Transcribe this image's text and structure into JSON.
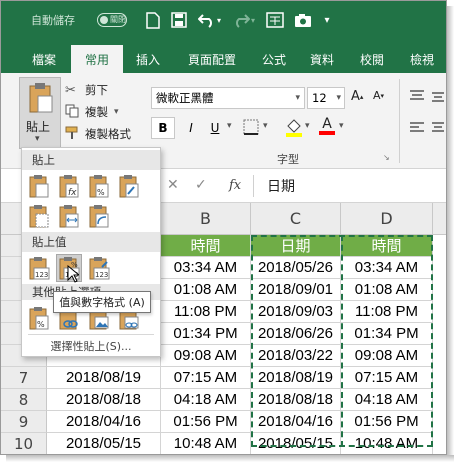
{
  "qat": {
    "autosave_label": "自動儲存",
    "toggle_state": "關閉"
  },
  "tabs": [
    "檔案",
    "常用",
    "插入",
    "頁面配置",
    "公式",
    "資料",
    "校閱",
    "檢視"
  ],
  "ribbon": {
    "paste_label": "貼上",
    "cut_label": "剪下",
    "copy_label": "複製",
    "format_painter_label": "複製格式",
    "font_name": "微軟正黑體",
    "font_size": "12",
    "bold": "B",
    "italic": "I",
    "underline": "U",
    "font_group_label": "字型"
  },
  "formula": {
    "fx_label": "fx",
    "content": "日期"
  },
  "paste_menu": {
    "section_paste": "貼上",
    "section_values": "貼上值",
    "section_other": "其他貼上選項",
    "tooltip": "值與數字格式 (A)",
    "paste_special": "選擇性貼上(S)..."
  },
  "sheet": {
    "columns": [
      "B",
      "C",
      "D"
    ],
    "header_row": [
      "時間",
      "日期",
      "時間"
    ],
    "rows": [
      {
        "num": "",
        "b": "03:34 AM",
        "c": "2018/05/26",
        "d": "03:34 AM"
      },
      {
        "num": "",
        "b": "01:08 AM",
        "c": "2018/09/01",
        "d": "01:08 AM"
      },
      {
        "num": "",
        "b": "11:08 PM",
        "c": "2018/09/03",
        "d": "11:08 PM"
      },
      {
        "num": "",
        "b": "01:34 PM",
        "c": "2018/06/26",
        "d": "01:34 PM"
      },
      {
        "num": "",
        "b": "09:08 AM",
        "c": "2018/03/22",
        "d": "09:08 AM"
      },
      {
        "num": "7",
        "a": "2018/08/19",
        "b": "07:15 AM",
        "c": "2018/08/19",
        "d": "07:15 AM"
      },
      {
        "num": "8",
        "a": "2018/08/18",
        "b": "04:18 AM",
        "c": "2018/08/18",
        "d": "04:18 AM"
      },
      {
        "num": "9",
        "a": "2018/04/16",
        "b": "01:56 PM",
        "c": "2018/04/16",
        "d": "01:56 PM"
      },
      {
        "num": "10",
        "a": "2018/05/15",
        "b": "10:48 AM",
        "c": "2018/05/15",
        "d": "10:48 AM"
      }
    ]
  },
  "colors": {
    "excel_green": "#217346",
    "header_fill": "#70ad47"
  }
}
